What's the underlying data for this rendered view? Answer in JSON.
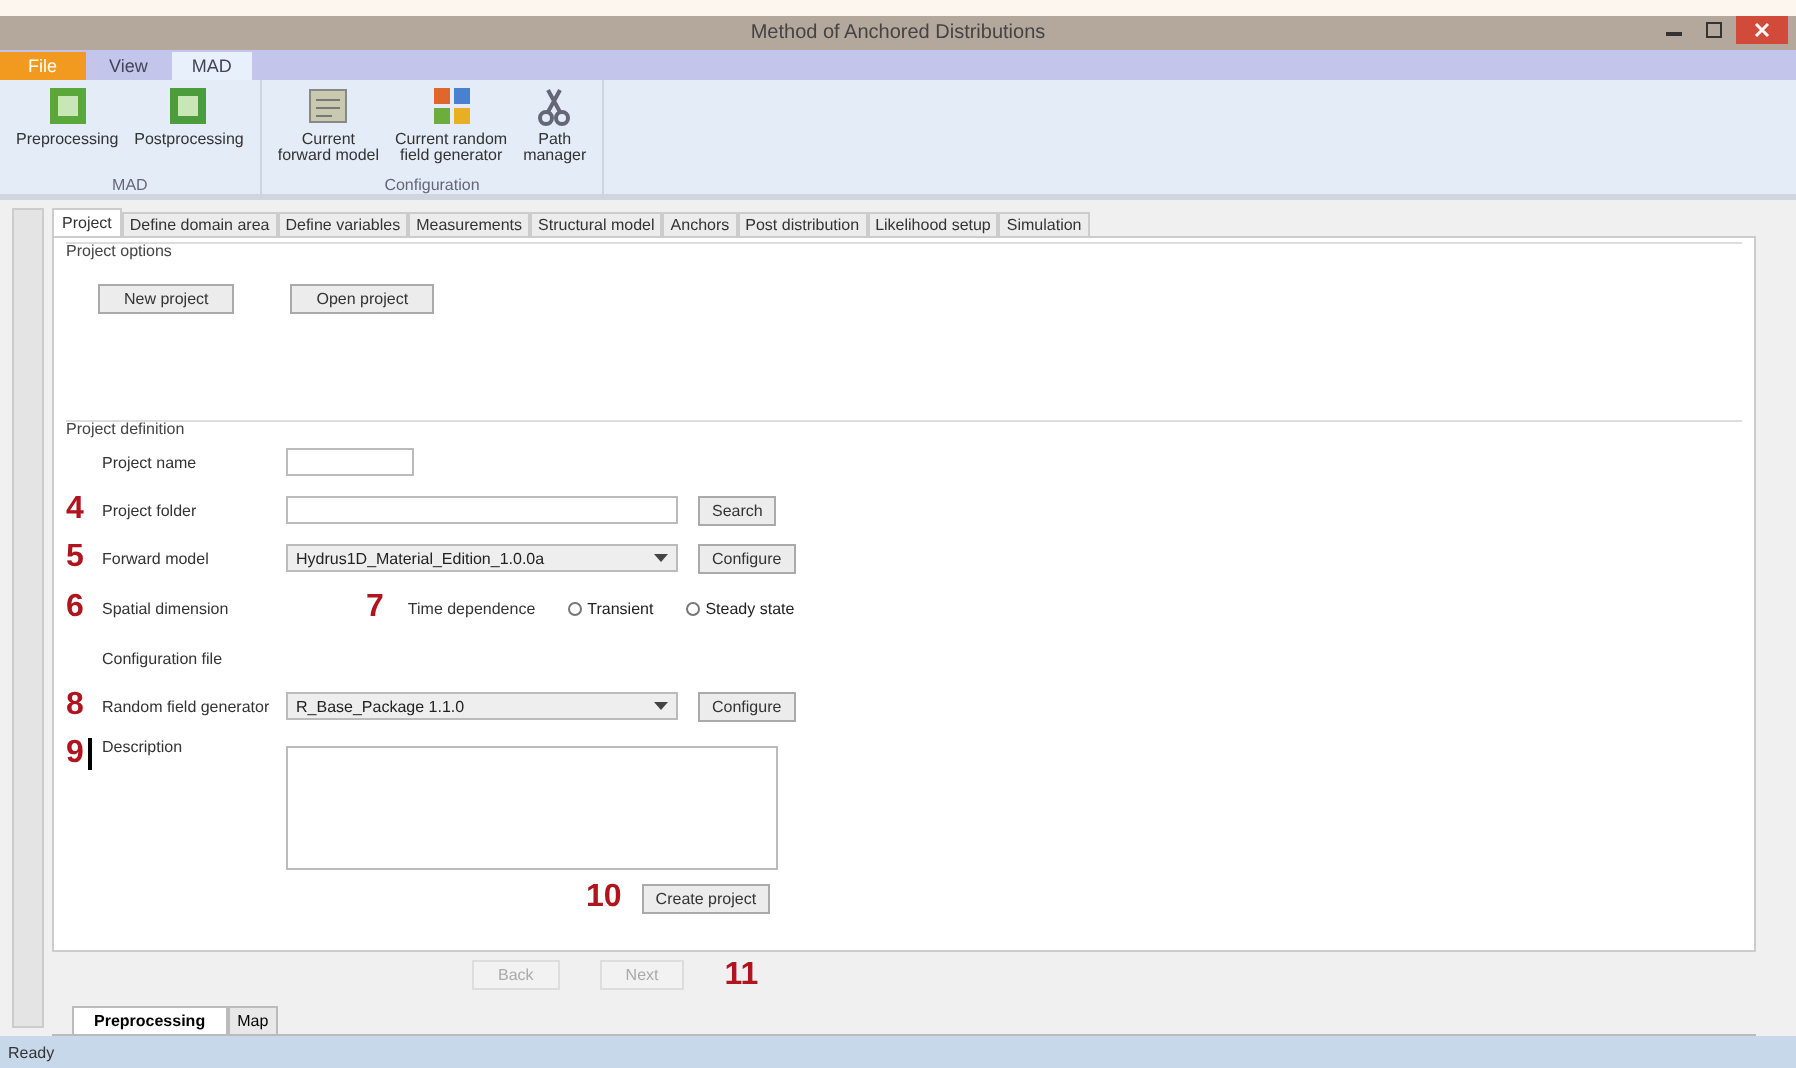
{
  "window": {
    "title": "Method of Anchored Distributions"
  },
  "ribbon_tabs": [
    {
      "label": "File",
      "kind": "file",
      "selected": false
    },
    {
      "label": "View",
      "kind": "tab",
      "selected": false
    },
    {
      "label": "MAD",
      "kind": "tab",
      "selected": true
    }
  ],
  "ribbon_groups": [
    {
      "label": "MAD",
      "buttons": [
        {
          "label": "Preprocessing",
          "kind": "pre"
        },
        {
          "label": "Postprocessing",
          "kind": "post"
        }
      ]
    },
    {
      "label": "Configuration",
      "buttons": [
        {
          "label": "Current\nforward model",
          "kind": "model"
        },
        {
          "label": "Current random\nfield generator",
          "kind": "generator"
        },
        {
          "label": "Path\nmanager",
          "kind": "path"
        }
      ]
    }
  ],
  "tabs": [
    {
      "label": "Project",
      "selected": true
    },
    {
      "label": "Define domain area",
      "selected": false
    },
    {
      "label": "Define variables",
      "selected": false
    },
    {
      "label": "Measurements",
      "selected": false
    },
    {
      "label": "Structural model",
      "selected": false
    },
    {
      "label": "Anchors",
      "selected": false
    },
    {
      "label": "Post distribution",
      "selected": false
    },
    {
      "label": "Likelihood setup",
      "selected": false
    },
    {
      "label": "Simulation",
      "selected": false
    }
  ],
  "project_options": {
    "title": "Project options",
    "buttons": [
      "New project",
      "Open project"
    ]
  },
  "project_definition": {
    "title": "Project definition",
    "project_name": {
      "label": "Project name"
    },
    "project_folder": {
      "label": "Project folder",
      "button": "Search"
    },
    "forward_model": {
      "label": "Forward model",
      "value": "Hydrus1D_Material_Edition_1.0.0a",
      "button": "Configure"
    },
    "spatial_dimension": {
      "label": "Spatial dimension"
    },
    "time_dependence": {
      "label": "Time dependence",
      "options": [
        {
          "label": "Transient",
          "selected": false
        },
        {
          "label": "Steady state",
          "selected": false
        }
      ]
    },
    "configuration_file": {
      "label": "Configuration file"
    },
    "random_field_generator": {
      "label": "Random field generator",
      "value": "R_Base_Package 1.1.0",
      "button": "Configure"
    },
    "description": {
      "label": "Description"
    },
    "create_button": "Create project"
  },
  "nav_buttons": [
    {
      "label": "Back",
      "disabled": true
    },
    {
      "label": "Next",
      "disabled": true
    }
  ],
  "annotations": [
    "4",
    "5",
    "6",
    "7",
    "8",
    "9",
    "10",
    "11"
  ],
  "bottom_tabs": [
    {
      "label": "Preprocessing",
      "selected": true
    },
    {
      "label": "Map",
      "selected": false
    }
  ],
  "status_bar": {
    "text": "Ready"
  }
}
